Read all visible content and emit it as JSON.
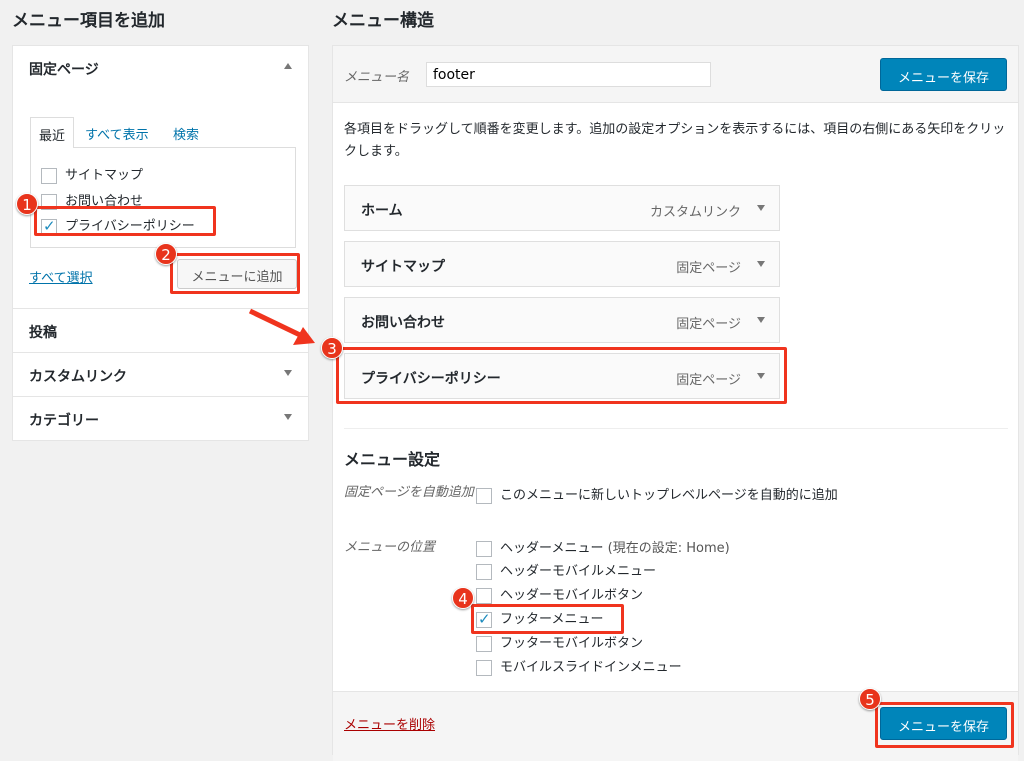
{
  "left": {
    "title": "メニュー項目を追加",
    "pages_section": "固定ページ",
    "tabs": [
      "最近",
      "すべて表示",
      "検索"
    ],
    "pages": [
      {
        "label": "サイトマップ",
        "checked": false
      },
      {
        "label": "お問い合わせ",
        "checked": false
      },
      {
        "label": "プライバシーポリシー",
        "checked": true
      }
    ],
    "select_all": "すべて選択",
    "add_button": "メニューに追加",
    "sections": [
      "投稿",
      "カスタムリンク",
      "カテゴリー"
    ]
  },
  "right": {
    "title": "メニュー構造",
    "menu_name_label": "メニュー名",
    "menu_name_value": "footer",
    "save_button": "メニューを保存",
    "description": "各項目をドラッグして順番を変更します。追加の設定オプションを表示するには、項目の右側にある矢印をクリックします。",
    "items": [
      {
        "label": "ホーム",
        "type": "カスタムリンク"
      },
      {
        "label": "サイトマップ",
        "type": "固定ページ"
      },
      {
        "label": "お問い合わせ",
        "type": "固定ページ"
      },
      {
        "label": "プライバシーポリシー",
        "type": "固定ページ"
      }
    ],
    "settings_title": "メニュー設定",
    "auto_add_label": "固定ページを自動追加",
    "auto_add_option": "このメニューに新しいトップレベルページを自動的に追加",
    "location_label": "メニューの位置",
    "locations": [
      {
        "label": "ヘッダーメニュー",
        "note": "(現在の設定: Home)",
        "checked": false
      },
      {
        "label": "ヘッダーモバイルメニュー",
        "checked": false
      },
      {
        "label": "ヘッダーモバイルボタン",
        "checked": false
      },
      {
        "label": "フッターメニュー",
        "checked": true
      },
      {
        "label": "フッターモバイルボタン",
        "checked": false
      },
      {
        "label": "モバイルスライドインメニュー",
        "checked": false
      }
    ],
    "delete_link": "メニューを削除"
  },
  "annotations": [
    "1",
    "2",
    "3",
    "4",
    "5"
  ],
  "colors": {
    "accent": "#0085ba",
    "annotation": "#f0341e",
    "link": "#0073aa"
  }
}
